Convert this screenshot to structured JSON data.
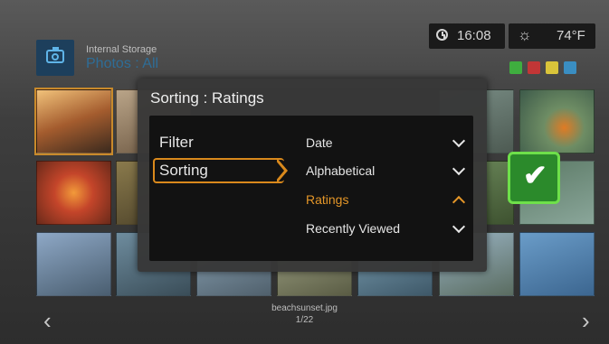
{
  "header": {
    "time": "16:08",
    "temperature": "74°F",
    "storage": "Internal Storage",
    "section": "Photos : All"
  },
  "dialog": {
    "title": "Sorting : Ratings",
    "left_menu": [
      "Filter",
      "Sorting"
    ],
    "options": [
      {
        "label": "Date",
        "state": "collapsed"
      },
      {
        "label": "Alphabetical",
        "state": "collapsed"
      },
      {
        "label": "Ratings",
        "state": "selected"
      },
      {
        "label": "Recently Viewed",
        "state": "collapsed"
      }
    ],
    "confirm_icon": "check-icon"
  },
  "footer": {
    "filename": "beachsunset.jpg",
    "page": "1/22"
  },
  "colors": {
    "accent": "#d9891c",
    "confirm": "#2b8a2b",
    "storage_blue": "#5fb4e8",
    "tag_colors": [
      "#3fae3f",
      "#c23636",
      "#d9c43a",
      "#3a8ec2"
    ]
  }
}
